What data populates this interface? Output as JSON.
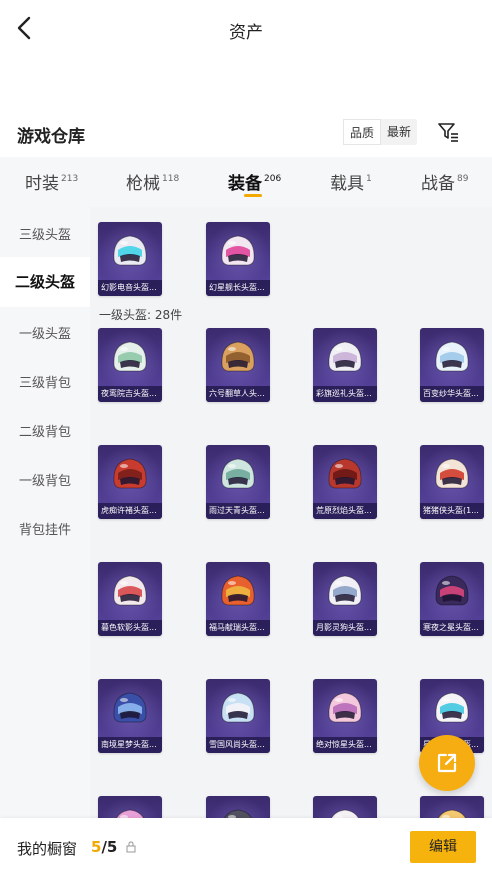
{
  "header": {
    "title": "资产"
  },
  "warehouse": {
    "title": "游戏仓库",
    "sort_options": [
      "品质",
      "最新"
    ],
    "active_sort": "品质"
  },
  "tabs": [
    {
      "label": "时装",
      "count": "213"
    },
    {
      "label": "枪械",
      "count": "118"
    },
    {
      "label": "装备",
      "count": "206"
    },
    {
      "label": "载具",
      "count": "1"
    },
    {
      "label": "战备",
      "count": "89"
    }
  ],
  "active_tab": "装备",
  "sidebar": [
    {
      "label": "三级头盔"
    },
    {
      "label": "二级头盔"
    },
    {
      "label": "一级头盔"
    },
    {
      "label": "三级背包"
    },
    {
      "label": "二级背包"
    },
    {
      "label": "一级背包"
    },
    {
      "label": "背包挂件"
    }
  ],
  "active_sidebar": "二级头盔",
  "section_label": "一级头盔: 28件",
  "items": [
    {
      "name": "幻影电音头盔...",
      "c1": "#eaeaf3",
      "c2": "#3fd3e8"
    },
    {
      "name": "幻星舰长头盔...",
      "c1": "#f2e6f0",
      "c2": "#e0459a"
    },
    {
      "name": "夜鸾院吉头盔...",
      "c1": "#e6f0ea",
      "c2": "#8fc8a8"
    },
    {
      "name": "六号翻草人头...",
      "c1": "#d9a060",
      "c2": "#8a5a2a"
    },
    {
      "name": "彩旗巡礼头盔...",
      "c1": "#f0f0f4",
      "c2": "#c8b0d8"
    },
    {
      "name": "百变纱华头盔...",
      "c1": "#e8f2fa",
      "c2": "#9ec8ea"
    },
    {
      "name": "虎痴许褚头盔...",
      "c1": "#c83c30",
      "c2": "#7a1e1a"
    },
    {
      "name": "雨过天青头盔...",
      "c1": "#cfe6e0",
      "c2": "#6fa89a"
    },
    {
      "name": "荒原烈焰头盔...",
      "c1": "#b8382e",
      "c2": "#6a1814"
    },
    {
      "name": "猪猪侠头盔(1...",
      "c1": "#f4e4d8",
      "c2": "#d03c2c"
    },
    {
      "name": "暮色软影头盔...",
      "c1": "#f3e8ec",
      "c2": "#d8484a"
    },
    {
      "name": "福马献瑞头盔...",
      "c1": "#e8602e",
      "c2": "#f0b840"
    },
    {
      "name": "月影灵狗头盔...",
      "c1": "#f0f0f6",
      "c2": "#8aa0c8"
    },
    {
      "name": "寒夜之冕头盔...",
      "c1": "#3a2a5c",
      "c2": "#d8447a"
    },
    {
      "name": "南境星梦头盔...",
      "c1": "#3a4fa8",
      "c2": "#8fb8f0"
    },
    {
      "name": "雪国风尚头盔...",
      "c1": "#c8e0f4",
      "c2": "#f4f4f8"
    },
    {
      "name": "绝对惊星头盔...",
      "c1": "#f4c8dc",
      "c2": "#b86ab8"
    },
    {
      "name": "星链守卫头盔...",
      "c1": "#f4f4f8",
      "c2": "#40c8e0"
    },
    {
      "name": "",
      "c1": "#e8a0d8",
      "c2": "#f4d8f0"
    },
    {
      "name": "",
      "c1": "#505060",
      "c2": "#8a8a98"
    },
    {
      "name": "",
      "c1": "#f4f0f4",
      "c2": "#d8d0e0"
    },
    {
      "name": "",
      "c1": "#f4c870",
      "c2": "#e8a040"
    }
  ],
  "bottom": {
    "window_label": "我的橱窗",
    "count_current": "5",
    "count_total": "/5",
    "edit_label": "编辑"
  },
  "colors": {
    "accent": "#f2a900",
    "card_bg": "#4c3a8c"
  }
}
